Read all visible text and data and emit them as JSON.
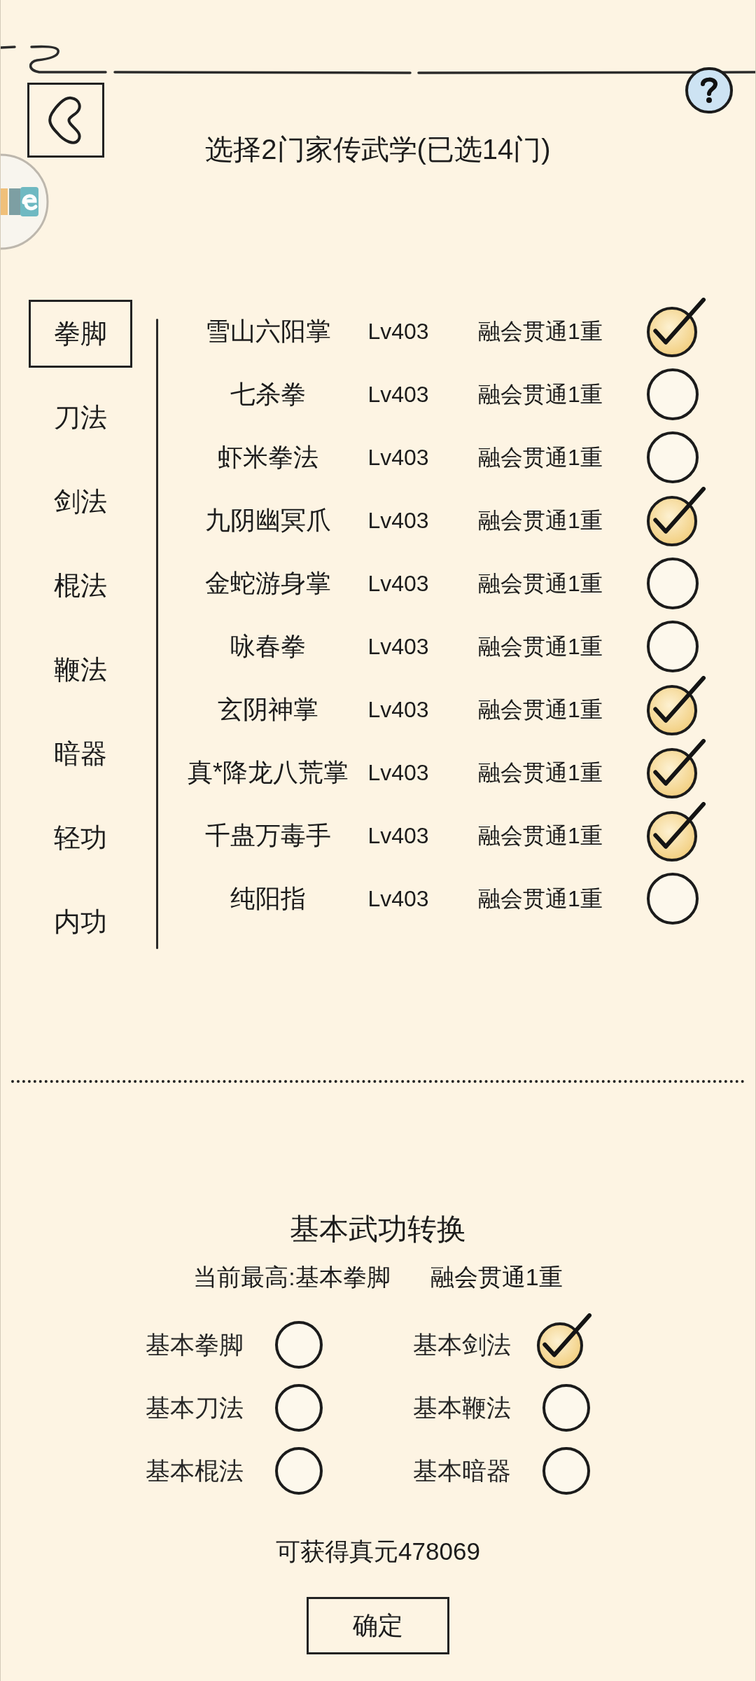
{
  "header": {
    "title": "选择2门家传武学(已选14门)"
  },
  "categories": [
    {
      "label": "拳脚",
      "selected": true
    },
    {
      "label": "刀法",
      "selected": false
    },
    {
      "label": "剑法",
      "selected": false
    },
    {
      "label": "棍法",
      "selected": false
    },
    {
      "label": "鞭法",
      "selected": false
    },
    {
      "label": "暗器",
      "selected": false
    },
    {
      "label": "轻功",
      "selected": false
    },
    {
      "label": "内功",
      "selected": false
    }
  ],
  "skills": [
    {
      "name": "雪山六阳掌",
      "rank": "Lv403",
      "realm": "融会贯通1重",
      "checked": true
    },
    {
      "name": "七杀拳",
      "rank": "Lv403",
      "realm": "融会贯通1重",
      "checked": false
    },
    {
      "name": "虾米拳法",
      "rank": "Lv403",
      "realm": "融会贯通1重",
      "checked": false
    },
    {
      "name": "九阴幽冥爪",
      "rank": "Lv403",
      "realm": "融会贯通1重",
      "checked": true
    },
    {
      "name": "金蛇游身掌",
      "rank": "Lv403",
      "realm": "融会贯通1重",
      "checked": false
    },
    {
      "name": "咏春拳",
      "rank": "Lv403",
      "realm": "融会贯通1重",
      "checked": false
    },
    {
      "name": "玄阴神掌",
      "rank": "Lv403",
      "realm": "融会贯通1重",
      "checked": true
    },
    {
      "name": "真*降龙八荒掌",
      "rank": "Lv403",
      "realm": "融会贯通1重",
      "checked": true
    },
    {
      "name": "千蛊万毒手",
      "rank": "Lv403",
      "realm": "融会贯通1重",
      "checked": true
    },
    {
      "name": "纯阳指",
      "rank": "Lv403",
      "realm": "融会贯通1重",
      "checked": false
    }
  ],
  "conversion": {
    "title": "基本武功转换",
    "current": "当前最高:基本拳脚",
    "current_realm": "融会贯通1重",
    "options": [
      {
        "label": "基本拳脚",
        "checked": false
      },
      {
        "label": "基本剑法",
        "checked": true
      },
      {
        "label": "基本刀法",
        "checked": false
      },
      {
        "label": "基本鞭法",
        "checked": false
      },
      {
        "label": "基本棍法",
        "checked": false
      },
      {
        "label": "基本暗器",
        "checked": false
      }
    ],
    "reward": "可获得真元478069"
  },
  "confirm_button": "确定"
}
